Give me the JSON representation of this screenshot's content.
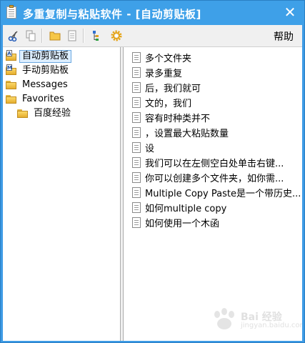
{
  "window": {
    "title": "多重复制与粘贴软件 - [自动剪贴板]",
    "close_glyph": "✕"
  },
  "toolbar": {
    "buttons": [
      "scissors-icon",
      "copy-icon",
      "folder-icon",
      "document-icon",
      "tree-icon",
      "gear-icon"
    ],
    "help_label": "帮助"
  },
  "tree": {
    "items": [
      {
        "label": "自动剪贴板",
        "badge": "A",
        "selected": true
      },
      {
        "label": "手动剪贴板",
        "badge": "M",
        "selected": false
      },
      {
        "label": "Messages",
        "badge": "",
        "selected": false
      },
      {
        "label": "Favorites",
        "badge": "",
        "selected": false
      },
      {
        "label": "百度经验",
        "badge": "",
        "selected": false
      }
    ]
  },
  "list": {
    "items": [
      "多个文件夹",
      "录多重复",
      "后，我们就可",
      "文的，我们",
      "容有时种类并不",
      "，设置最大粘贴数量",
      "设",
      "我们可以在左侧空白处单击右键...",
      "你可以创建多个文件夹，如你需...",
      "Multiple Copy Paste是一个带历史...",
      "如何multiple copy",
      "如何使用一个木函"
    ]
  },
  "watermark": {
    "text": "Bai 经验",
    "sub": "jingyan.baidu.com"
  },
  "colors": {
    "titlebar": "#3ea0e8",
    "selection_border": "#6ba8e0",
    "selection_fill": "#ddeeff"
  }
}
